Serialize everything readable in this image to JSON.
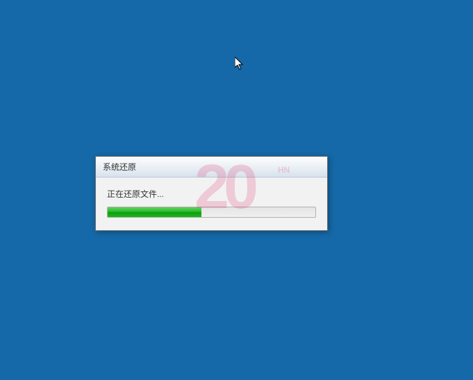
{
  "dialog": {
    "title": "系统还原",
    "status_text": "正在还原文件...",
    "progress_percent": 45
  },
  "watermark": {
    "main": "20",
    "sub": "HN"
  }
}
